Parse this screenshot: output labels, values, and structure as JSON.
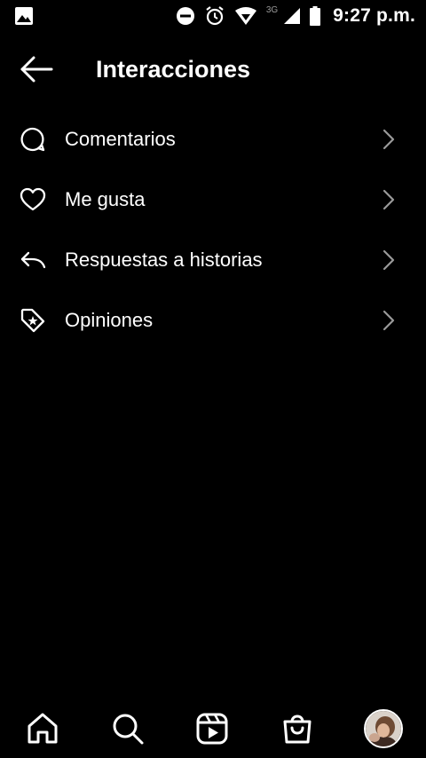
{
  "status_bar": {
    "time": "9:27 p.m.",
    "network": "3G"
  },
  "header": {
    "title": "Interacciones"
  },
  "menu": {
    "items": [
      {
        "label": "Comentarios",
        "icon": "comment-icon"
      },
      {
        "label": "Me gusta",
        "icon": "heart-icon"
      },
      {
        "label": "Respuestas a historias",
        "icon": "reply-icon"
      },
      {
        "label": "Opiniones",
        "icon": "review-tag-icon"
      }
    ]
  },
  "bottom_nav": {
    "items": [
      "home-icon",
      "search-icon",
      "reels-icon",
      "shop-icon",
      "profile-avatar"
    ]
  },
  "colors": {
    "background": "#000000",
    "text": "#ffffff",
    "chevron": "#9a9a9a"
  }
}
